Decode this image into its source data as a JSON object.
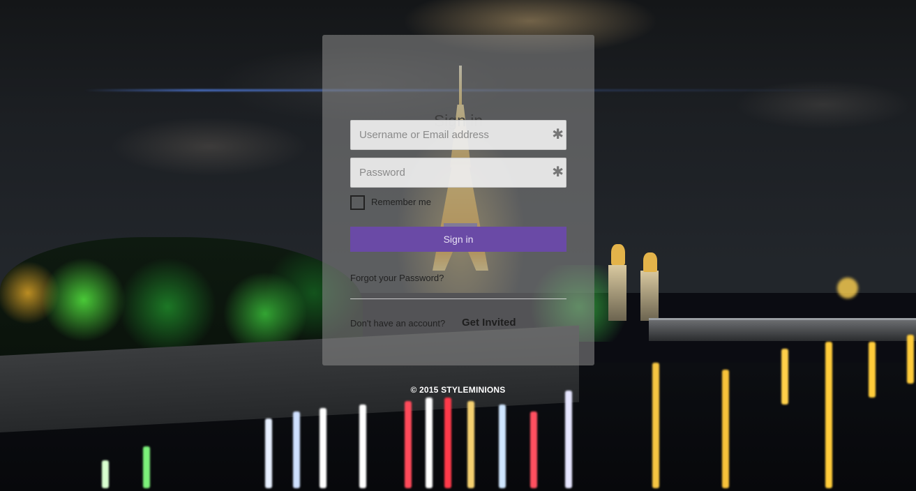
{
  "login": {
    "title": "Sign in",
    "username_placeholder": "Username or Email address",
    "password_placeholder": "Password",
    "required_marker": "✱",
    "remember_label": "Remember me",
    "remember_checked": false,
    "signin_label": "Sign in",
    "forgot_label": "Forgot your Password?",
    "no_account_label": "Don't have an account?",
    "invite_label": "Get Invited"
  },
  "footer": {
    "copyright": "© 2015 STYLEMINIONS"
  },
  "colors": {
    "panel_bg": "#848484",
    "button_bg": "#6a4aa6",
    "button_text": "#e9e2f5"
  }
}
